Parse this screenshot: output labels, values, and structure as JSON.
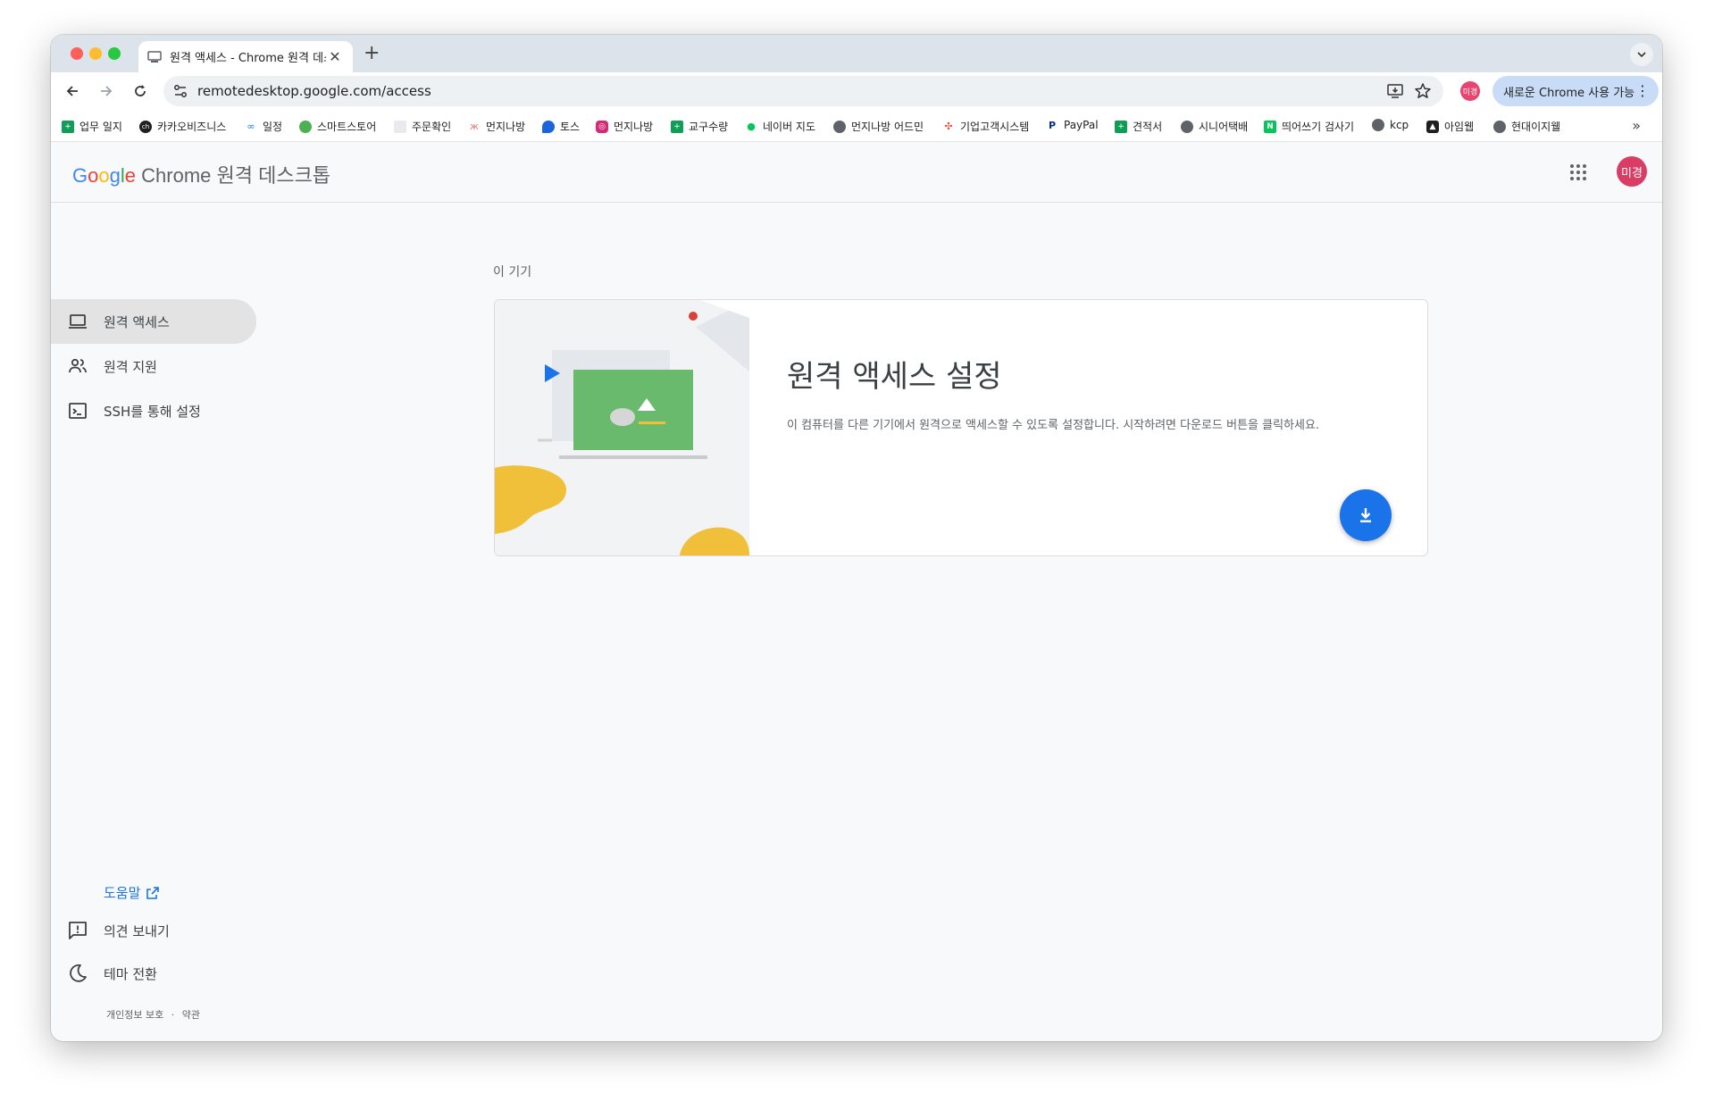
{
  "browser": {
    "tab_title": "원격 액세스 - Chrome 원격 데스크",
    "url": "remotedesktop.google.com/access",
    "profile_initials": "미경",
    "update_label": "새로운 Chrome 사용 가능",
    "bookmarks": [
      {
        "label": "업무 일지",
        "icon": "sheets-icon",
        "color": "#0f9d58"
      },
      {
        "label": "카카오비즈니스",
        "icon": "kakao-ch-icon",
        "color": "#1f1f1f"
      },
      {
        "label": "일정",
        "icon": "meta-icon",
        "color": "#1877f2"
      },
      {
        "label": "스마트스토어",
        "icon": "smartstore-icon",
        "color": "#4caf50"
      },
      {
        "label": "주문확인",
        "icon": "page-icon",
        "color": "#cccccc"
      },
      {
        "label": "먼지나방",
        "icon": "butterfly-icon",
        "color": "#e57373"
      },
      {
        "label": "토스",
        "icon": "toss-icon",
        "color": "#1b64da"
      },
      {
        "label": "먼지나방",
        "icon": "instagram-icon",
        "color": "#d62976"
      },
      {
        "label": "교구수량",
        "icon": "sheets-icon",
        "color": "#0f9d58"
      },
      {
        "label": "네이버 지도",
        "icon": "map-pin-icon",
        "color": "#03c75a"
      },
      {
        "label": "먼지나방 어드민",
        "icon": "globe-icon",
        "color": "#5f6368"
      },
      {
        "label": "기업고객시스템",
        "icon": "pinwheel-icon",
        "color": "#ea4335"
      },
      {
        "label": "PayPal",
        "icon": "paypal-icon",
        "color": "#003087"
      },
      {
        "label": "견적서",
        "icon": "sheets-icon",
        "color": "#0f9d58"
      },
      {
        "label": "시니어택배",
        "icon": "globe-icon",
        "color": "#5f6368"
      },
      {
        "label": "띄어쓰기 검사기",
        "icon": "naver-icon",
        "color": "#03c75a"
      },
      {
        "label": "kcp",
        "icon": "globe-icon",
        "color": "#5f6368"
      },
      {
        "label": "아임웹",
        "icon": "imweb-icon",
        "color": "#1f1f1f"
      },
      {
        "label": "현대이지웰",
        "icon": "globe-icon",
        "color": "#5f6368"
      }
    ]
  },
  "app": {
    "logo_google": "Google",
    "logo_product": "Chrome 원격 데스크톱",
    "avatar_initials": "미경"
  },
  "sidebar": {
    "items": [
      {
        "label": "원격 액세스",
        "icon": "laptop-icon",
        "active": true
      },
      {
        "label": "원격 지원",
        "icon": "people-icon",
        "active": false
      },
      {
        "label": "SSH를 통해 설정",
        "icon": "terminal-icon",
        "active": false
      }
    ],
    "help_label": "도움말",
    "feedback_label": "의견 보내기",
    "theme_label": "테마 전환",
    "privacy_label": "개인정보 보호",
    "separator": "·",
    "terms_label": "약관"
  },
  "main": {
    "section_title": "이 기기",
    "card_title": "원격 액세스 설정",
    "card_description": "이 컴퓨터를 다른 기기에서 원격으로 액세스할 수 있도록 설정합니다. 시작하려면 다운로드 버튼을 클릭하세요."
  },
  "colors": {
    "accent": "#1a73e8",
    "avatar": "#d93d66",
    "illustration_green": "#6aba6e",
    "illustration_yellow": "#f0c03a"
  }
}
